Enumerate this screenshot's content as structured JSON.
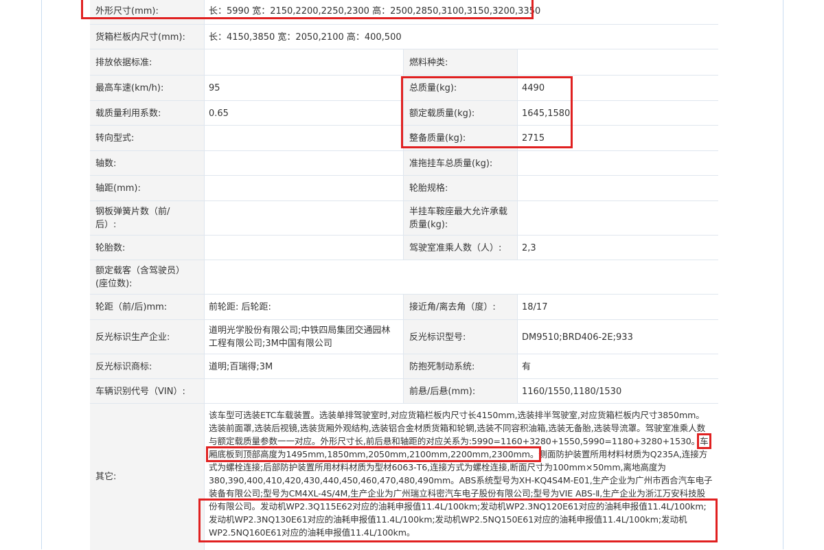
{
  "spec_table": {
    "rows": [
      {
        "label": "外形尺寸(mm):",
        "value": "长：5990 宽：2150,2200,2250,2300 高：2500,2850,3100,3150,3200,3350"
      },
      {
        "label": "货箱栏板内尺寸(mm):",
        "value": "长：4150,3850 宽：2050,2100 高：400,500"
      },
      {
        "label": "排放依据标准:",
        "value": "",
        "label2": "燃料种类:",
        "value2": ""
      },
      {
        "label": "最高车速(km/h):",
        "value": "95",
        "label2": "总质量(kg):",
        "value2": "4490"
      },
      {
        "label": "载质量利用系数:",
        "value": "0.65",
        "label2": "额定载质量(kg):",
        "value2": "1645,1580"
      },
      {
        "label": "转向型式:",
        "value": "",
        "label2": "整备质量(kg):",
        "value2": "2715"
      },
      {
        "label": "轴数:",
        "value": "",
        "label2": "准拖挂车总质量(kg):",
        "value2": ""
      },
      {
        "label": "轴距(mm):",
        "value": "",
        "label2": "轮胎规格:",
        "value2": ""
      },
      {
        "label": "钢板弹簧片数（前/后）:",
        "value": "",
        "label2": "半挂车鞍座最大允许承载质量(kg):",
        "value2": ""
      },
      {
        "label": "轮胎数:",
        "value": "",
        "label2": "驾驶室准乘人数（人）:",
        "value2": "2,3"
      },
      {
        "label": "额定载客（含驾驶员）(座位数):",
        "value": ""
      },
      {
        "label": "轮距（前/后)mm:",
        "value": "前轮距: 后轮距:",
        "label2": "接近角/离去角（度）:",
        "value2": "18/17"
      },
      {
        "label": "反光标识生产企业:",
        "value": "道明光学股份有限公司;中铁四局集团交通园林工程有限公司;3M中国有限公司",
        "label2": "反光标识型号:",
        "value2": "DM9510;BRD406-2E;933"
      },
      {
        "label": "反光标识商标:",
        "value": "道明;百瑞得;3M",
        "label2": "防抱死制动系统:",
        "value2": "有"
      },
      {
        "label": "车辆识别代号（VIN）:",
        "value": "",
        "label2": "前悬/后悬(mm):",
        "value2": "1160/1550,1180/1530"
      }
    ],
    "other": {
      "label": "其它:",
      "text_a": "该车型可选装ETC车载装置。选装单排驾驶室时,对应货箱栏板内尺寸长4150mm,选装排半驾驶室,对应货箱栏板内尺寸3850mm。选装前面罩,选装后视镜,选装货厢外观结构,选装铝合金材质货箱和轮辋,选装不同容积油箱,选装无备胎,选装导流罩。驾驶室准乘人数与额定载质量参数一一对应。外形尺寸长,前后悬和轴距的对应关系为:5990=1160+3280+1550,5990=1180+3280+1530。",
      "text_highlight": "车厢底板到顶部高度为1495mm,1850mm,2050mm,2100mm,2200mm,2300mm。",
      "text_b": "侧面防护装置所用材料材质为Q235A,连接方式为螺栓连接;后部防护装置所用材料材质为型材6063-T6,连接方式为螺栓连接,断面尺寸为100mm×50mm,离地高度为380,390,400,410,420,430,440,450,460,470,480,490mm。ABS系统型号为XH-KQ4S4M-E01,生产企业为广州市西合汽车电子装备有限公司;型号为CM4XL-4S/4M,生产企业为广州瑞立科密汽车电子股份有限公司;型号为VIE ABS-Ⅱ,生产企业为浙江万安科技股份有限公司。发动机WP2.3Q115E62对应的油耗申报值11.4L/100km;发动机WP2.3NQ120E61对应的油耗申报值11.4L/100km;发动机WP2.3NQ130E61对应的油耗申报值11.4L/100km;发动机WP2.5NQ150E61对应的油耗申报值11.4L/100km;发动机WP2.5NQ160E61对应的油耗申报值11.4L/100km。"
    }
  },
  "colors": {
    "highlight": "#e02020",
    "label_bg": "#f4f4f4",
    "border": "#dfe6ee"
  }
}
